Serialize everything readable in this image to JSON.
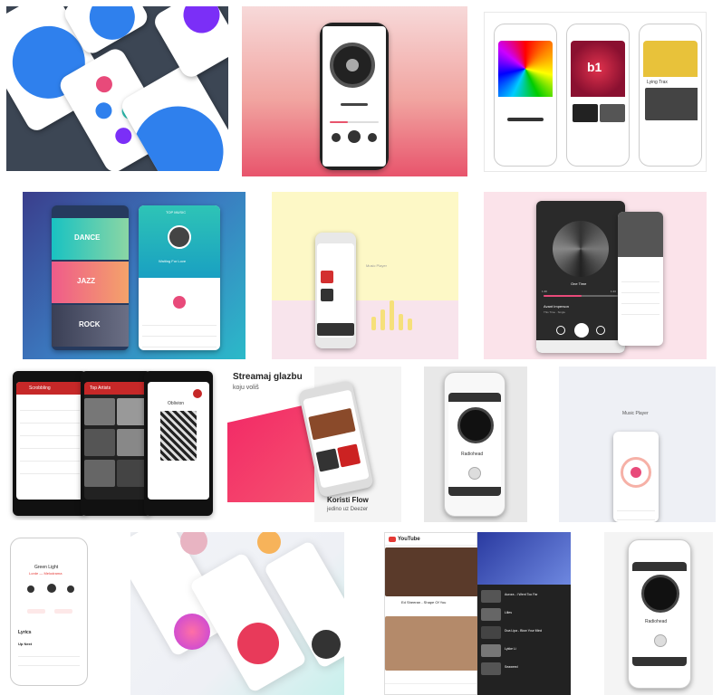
{
  "tiles": {
    "t3": {
      "app_label": "Lying Trax"
    },
    "t4": {
      "genre1": "DANCE",
      "genre2": "JAZZ",
      "genre3": "ROCK",
      "now_playing_header": "TOP MUSIC",
      "song": "Waiting For Love"
    },
    "t5": {
      "caption": "Music Player"
    },
    "t6": {
      "song": "One Time",
      "artist": "Avant Imperson",
      "subtitle": "This Time · Single",
      "time_left": "1:40",
      "time_right": "1:43"
    },
    "t7": {
      "left_header": "Scrobbling",
      "mid_header": "Top Artists",
      "right_title": "Oblivion"
    },
    "t8": {
      "headline": "Streamaj glazbu",
      "subline": "koju voliš",
      "footer_title": "Koristi Flow",
      "footer_sub": "jedino uz Deezer"
    },
    "t9": {
      "artist": "Radiohead"
    },
    "t10": {
      "caption": "Music Player"
    },
    "t11": {
      "song": "Green Light",
      "artist": "Lorde — Melodrama",
      "section_lyrics": "Lyrics",
      "section_up_next": "Up Next"
    },
    "t13": {
      "brand": "YouTube",
      "video_title": "Ed Sheeran - Shape Of You",
      "item1": "Aurora - I Went Too Far",
      "item2": "Lilies",
      "item3": "Dua Lipa - Blow Your Mind",
      "item4": "Lykke Li",
      "item5": "Seaweed"
    },
    "t14": {
      "artist": "Radiohead"
    }
  },
  "colors": {
    "blue": "#2f80ed",
    "red": "#d32f2f",
    "pink": "#e84a7a",
    "teal": "#2ec4b6",
    "purple": "#7b2ff7",
    "yellow": "#fff7b0"
  }
}
